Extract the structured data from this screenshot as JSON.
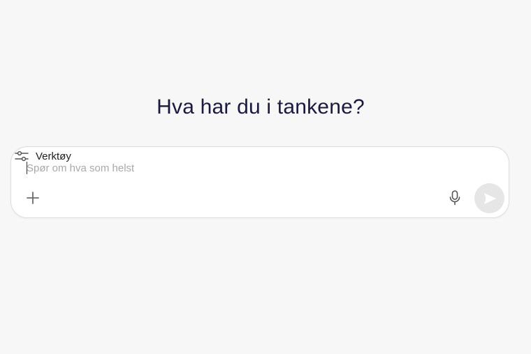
{
  "main": {
    "heading": "Hva har du i tankene?"
  },
  "composer": {
    "placeholder": "Spør om hva som helst",
    "value": "",
    "tools_label": "Verktøy"
  },
  "icons": {
    "add": "plus-icon",
    "tools": "sliders-icon",
    "mic": "microphone-icon",
    "send": "send-arrow-icon"
  },
  "colors": {
    "background": "#f7f7f7",
    "heading": "#1a1a40",
    "send_disabled": "#e6e6e6"
  }
}
